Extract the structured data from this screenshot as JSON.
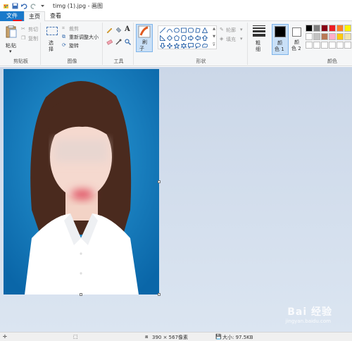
{
  "window": {
    "title": "timg (1).jpg - 画图"
  },
  "tabs": {
    "file": "文件",
    "home": "主页",
    "view": "查看"
  },
  "clipboard": {
    "paste": "粘",
    "paste2": "贴",
    "cut": "剪切",
    "copy": "复制",
    "label": "剪贴板"
  },
  "image": {
    "select": "选",
    "select2": "择",
    "crop": "裁剪",
    "resize": "重新调整大小",
    "rotate": "旋转",
    "label": "图像"
  },
  "tools": {
    "label": "工具"
  },
  "brush": {
    "label": "刷",
    "label2": "子"
  },
  "shapes": {
    "outline": "轮廓",
    "fill": "填充",
    "label": "形状"
  },
  "size": {
    "label": "粗",
    "label2": "细"
  },
  "colors": {
    "color1": "颜",
    "color1b": "色 1",
    "color2": "颜",
    "color2b": "色 2",
    "label": "颜色",
    "color1_value": "#000000",
    "color2_value": "#ffffff",
    "palette_row1": [
      "#000000",
      "#7f7f7f",
      "#880015",
      "#ed1c24",
      "#ff7f27",
      "#fff200"
    ],
    "palette_row2": [
      "#ffffff",
      "#c3c3c3",
      "#b97a57",
      "#ffaec9",
      "#ffc90e",
      "#efe4b0"
    ],
    "palette_row3": [
      "#ffffff",
      "#ffffff",
      "#ffffff",
      "#ffffff",
      "#ffffff",
      "#ffffff"
    ]
  },
  "status": {
    "dimensions": "390 × 567像素",
    "size": "大小: 97.5KB"
  },
  "watermark": {
    "brand": "Bai 经验",
    "url": "jingyan.baidu.com"
  }
}
